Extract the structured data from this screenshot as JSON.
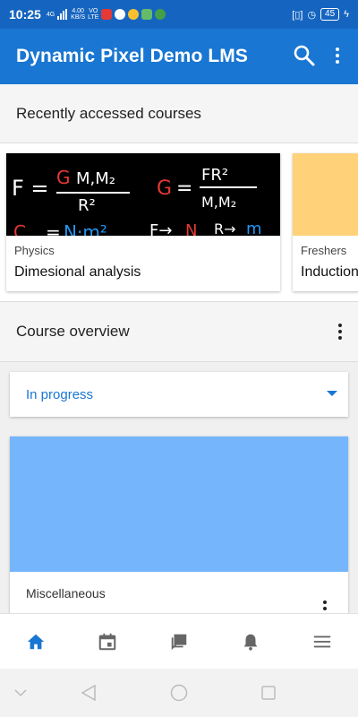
{
  "status_bar": {
    "time": "10:25",
    "network_4g": "4G",
    "net_speed_top": "4.00",
    "net_speed_bottom": "KB/S",
    "volte_top": "VO",
    "volte_bottom": "LTE",
    "battery": "45"
  },
  "app_bar": {
    "title": "Dynamic Pixel Demo LMS",
    "search_icon": "search-icon",
    "more_icon": "more-vert-icon"
  },
  "recent": {
    "heading": "Recently accessed courses",
    "courses": [
      {
        "category": "Physics",
        "name": "Dimesional analysis",
        "image_color": "#000000"
      },
      {
        "category": "Freshers",
        "name": "Induction",
        "image_color": "#ffd27a"
      }
    ]
  },
  "overview": {
    "heading": "Course overview",
    "filter_value": "In progress",
    "course": {
      "category": "Miscellaneous",
      "image_color": "#74b5fc"
    }
  },
  "tabs": [
    {
      "icon": "home-icon",
      "active": true
    },
    {
      "icon": "calendar-icon",
      "active": false
    },
    {
      "icon": "messages-icon",
      "active": false
    },
    {
      "icon": "bell-icon",
      "active": false
    },
    {
      "icon": "menu-icon",
      "active": false
    }
  ],
  "colors": {
    "primary": "#1976d2",
    "status_bar": "#1565c0",
    "accent_text": "#1976d2"
  }
}
